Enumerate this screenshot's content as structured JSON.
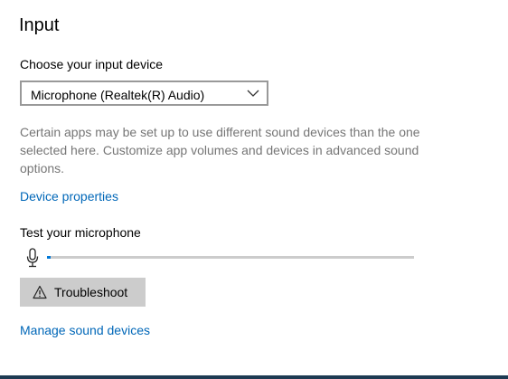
{
  "section": {
    "title": "Input"
  },
  "device_select": {
    "label": "Choose your input device",
    "selected": "Microphone (Realtek(R) Audio)",
    "icon": "chevron-down-icon"
  },
  "description": "Certain apps may be set up to use different sound devices than the one selected here. Customize app volumes and devices in advanced sound options.",
  "links": {
    "device_properties": "Device properties",
    "manage_sound_devices": "Manage sound devices"
  },
  "mic_test": {
    "label": "Test your microphone",
    "icon": "microphone-icon",
    "level": 0.01
  },
  "troubleshoot": {
    "label": "Troubleshoot",
    "icon": "warning-icon"
  },
  "colors": {
    "accent": "#0067b8",
    "level_fill": "#0078d7",
    "secondary_text": "#767676",
    "button_bg": "#cccccc"
  }
}
